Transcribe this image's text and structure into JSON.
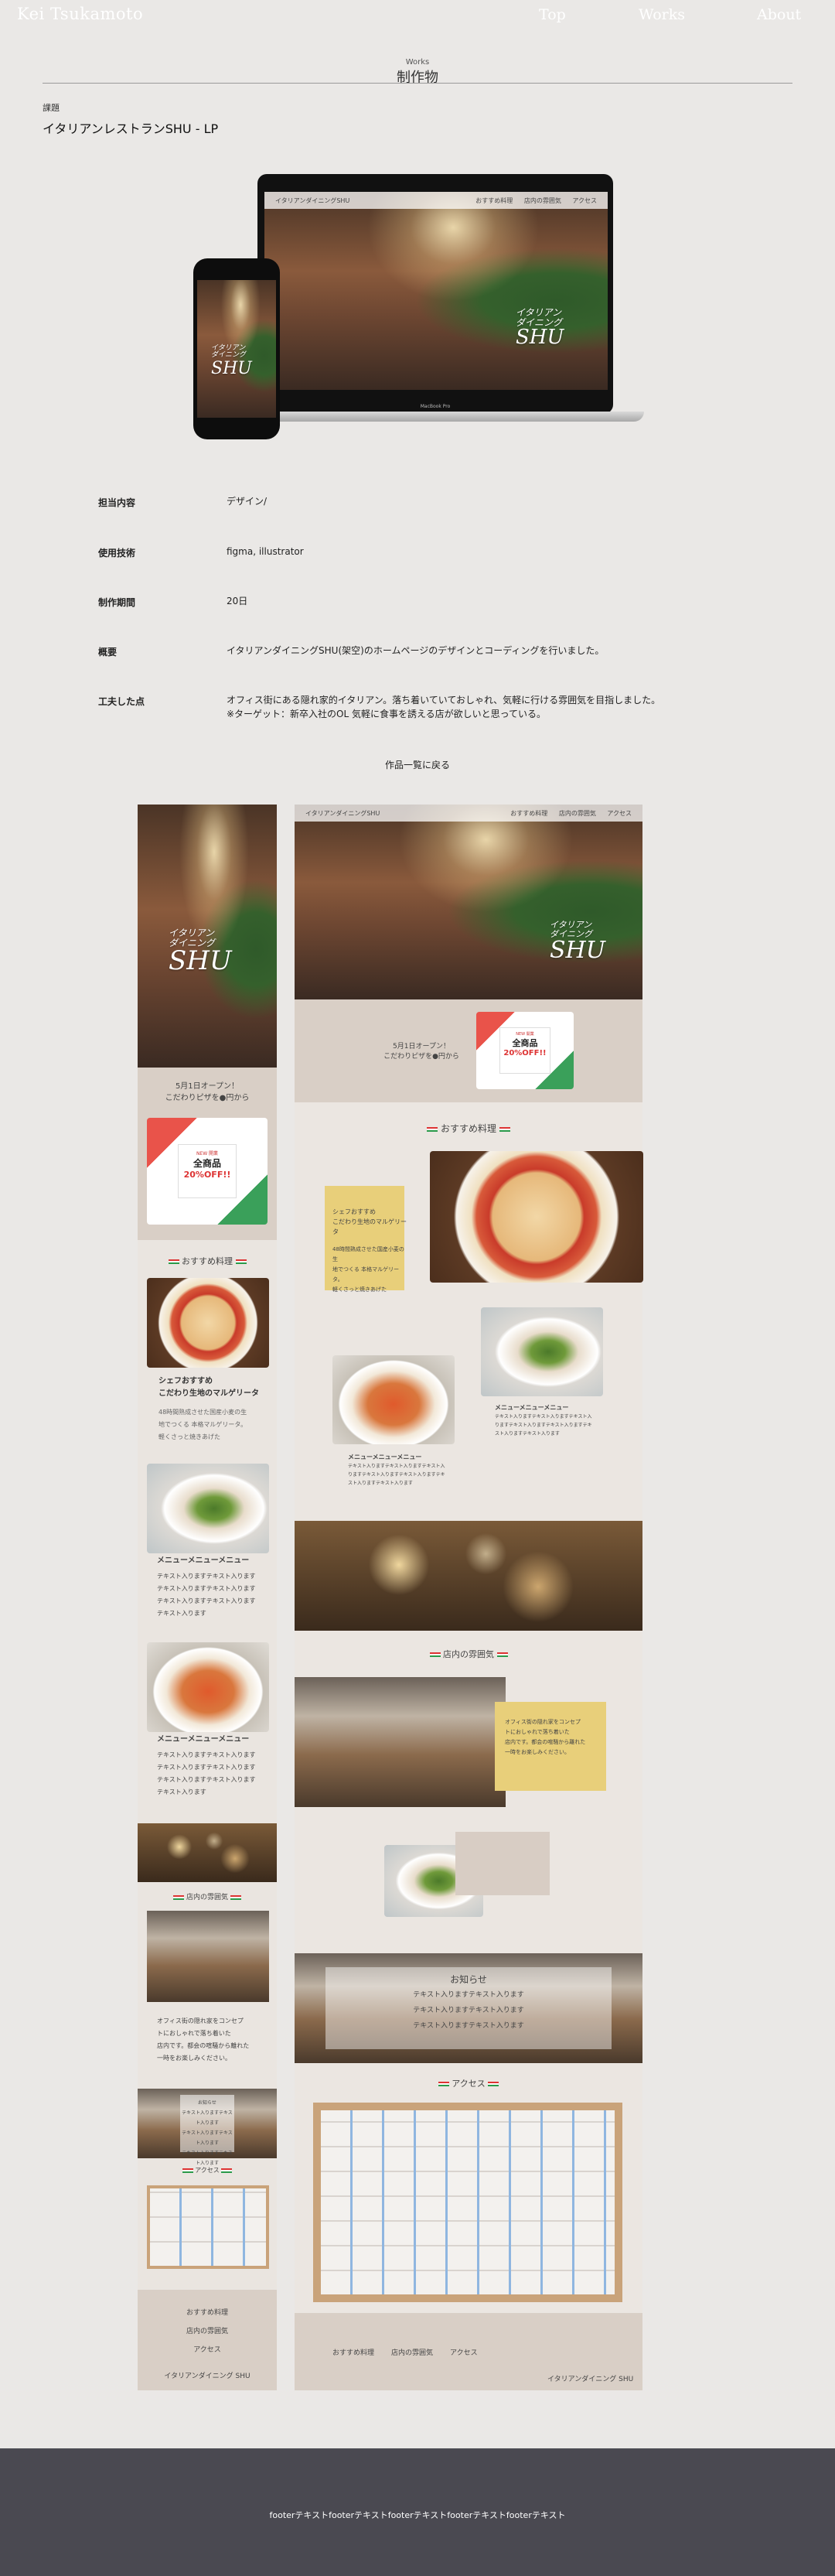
{
  "header": {
    "name": "Kei Tsukamoto",
    "nav": [
      "Top",
      "Works",
      "About"
    ]
  },
  "section": {
    "small": "Works",
    "title": "制作物"
  },
  "project": {
    "label": "課題",
    "title": "イタリアンレストランSHU - LP"
  },
  "mockup": {
    "nav_brand": "イタリアンダイニングSHU",
    "nav_links": [
      "おすすめ料理",
      "店内の雰囲気",
      "アクセス"
    ],
    "logo_line1": "イタリアン",
    "logo_line2": "ダイニング",
    "logo_main": "SHU",
    "laptop_brand": "MacBook Pro"
  },
  "details": [
    {
      "label": "担当内容",
      "value": "デザイン/"
    },
    {
      "label": "使用技術",
      "value": "figma, illustrator"
    },
    {
      "label": "制作期間",
      "value": "20日"
    },
    {
      "label": "概要",
      "value": "イタリアンダイニングSHU(架空)のホームページのデザインとコーディングを行いました。"
    },
    {
      "label": "工夫した点",
      "value": "オフィス街にある隠れ家的イタリアン。落ち着いていておしゃれ、気軽に行ける雰囲気を目指しました。",
      "value2": "※ターゲット：新卒入社のOL 気軽に食事を誘える店が欲しいと思っている。"
    }
  ],
  "back_link": "作品一覧に戻る",
  "lp": {
    "open_text1": "5月1日オープン！",
    "open_text2": "こだわりピザを●円から",
    "sale_top": "NEW 開業",
    "sale_main": "全商品",
    "sale_off": "20%OFF!!",
    "recommend_title": "おすすめ料理",
    "chef_title1": "シェフおすすめ",
    "chef_title2": "こだわり生地のマルゲリータ",
    "chef_text1": "48時間熟成させた国産小麦の生",
    "chef_text2": "地でつくる 本格マルゲリータ。",
    "chef_text3": "軽くさっと焼きあげた",
    "menu_title": "メニューメニューメニュー",
    "menu_text": "テキスト入りますテキスト入りますテキスト入りますテキスト入りますテキスト入りますテキスト入りますテキスト入ります",
    "atmos_title": "店内の雰囲気",
    "atmos_text1": "オフィス街の隠れ家をコンセプ",
    "atmos_text2": "トにおしゃれで落ち着いた",
    "atmos_text3": "店内です。都会の喧騒から離れた",
    "atmos_text4": "一時をお楽しみください。",
    "news_title": "お知らせ",
    "news_items": [
      "テキスト入りますテキスト入ります",
      "テキスト入りますテキスト入ります",
      "テキスト入りますテキスト入ります"
    ],
    "access_title": "アクセス",
    "footer_links": [
      "おすすめ料理",
      "店内の雰囲気",
      "アクセス"
    ],
    "footer_brand": "イタリアンダイニング SHU"
  },
  "footer": {
    "text": "footerテキストfooterテキストfooterテキストfooterテキストfooterテキスト"
  },
  "colors": {
    "background": "#eae8e6",
    "mock_bg": "#d9cfc6",
    "footer": "#4a4951",
    "accent_yellow": "#e8cf7a",
    "red": "#d33333",
    "green": "#2a9a4a"
  }
}
